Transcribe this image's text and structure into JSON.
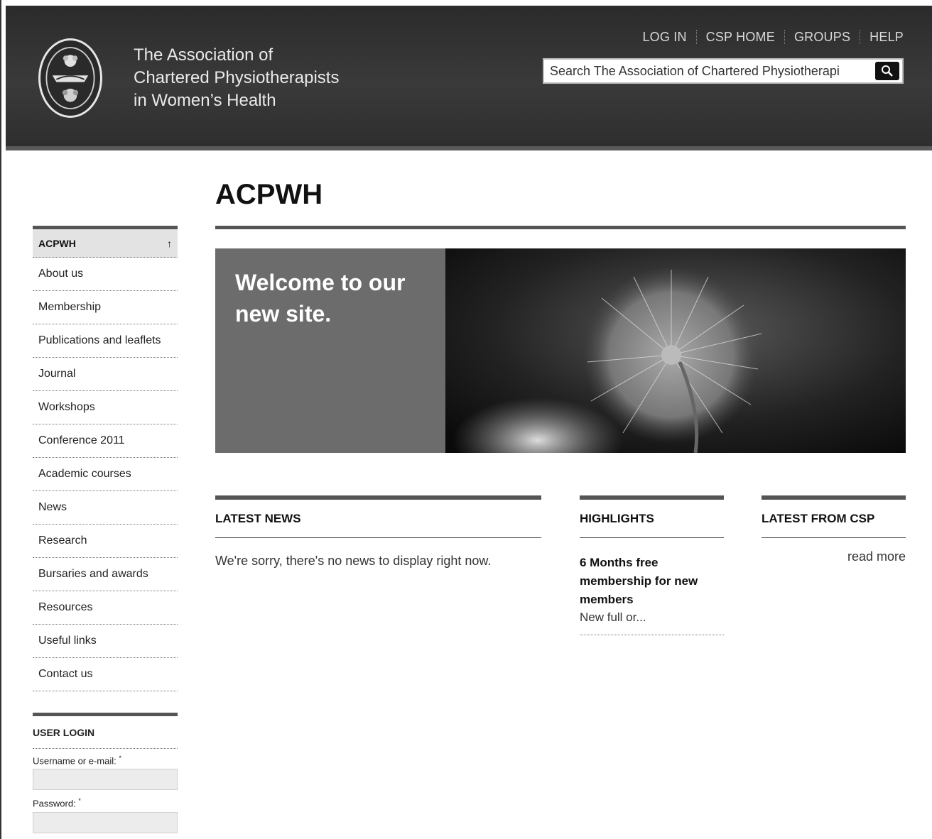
{
  "header": {
    "org_name_lines": [
      "The Association of",
      "Chartered Physiotherapists",
      "in Women’s Health"
    ],
    "nav": [
      "LOG IN",
      "CSP HOME",
      "GROUPS",
      "HELP"
    ],
    "search_placeholder": "Search The Association of Chartered Physiotherapi",
    "logo_icon": "crest-icon",
    "search_icon": "magnifier-icon"
  },
  "page": {
    "title": "ACPWH"
  },
  "sidebar": {
    "active": "ACPWH",
    "active_icon": "arrow-up-icon",
    "items": [
      "About us",
      "Membership",
      "Publications and leaflets",
      "Journal",
      "Workshops",
      "Conference 2011",
      "Academic courses",
      "News",
      "Research",
      "Bursaries and awards",
      "Resources",
      "Useful links",
      "Contact us"
    ]
  },
  "login": {
    "title": "USER LOGIN",
    "username_label": "Username or e-mail:",
    "password_label": "Password:",
    "required_mark": "*"
  },
  "hero": {
    "line1": "Welcome to our",
    "line2": "new site."
  },
  "latest_news": {
    "heading": "LATEST NEWS",
    "empty_text": "We're sorry, there's no news to display right now."
  },
  "highlights": {
    "heading": "HIGHLIGHTS",
    "item_title": "6 Months free membership for new members",
    "item_desc": "New full or..."
  },
  "latest_csp": {
    "heading": "LATEST FROM CSP",
    "read_more": "read more"
  }
}
